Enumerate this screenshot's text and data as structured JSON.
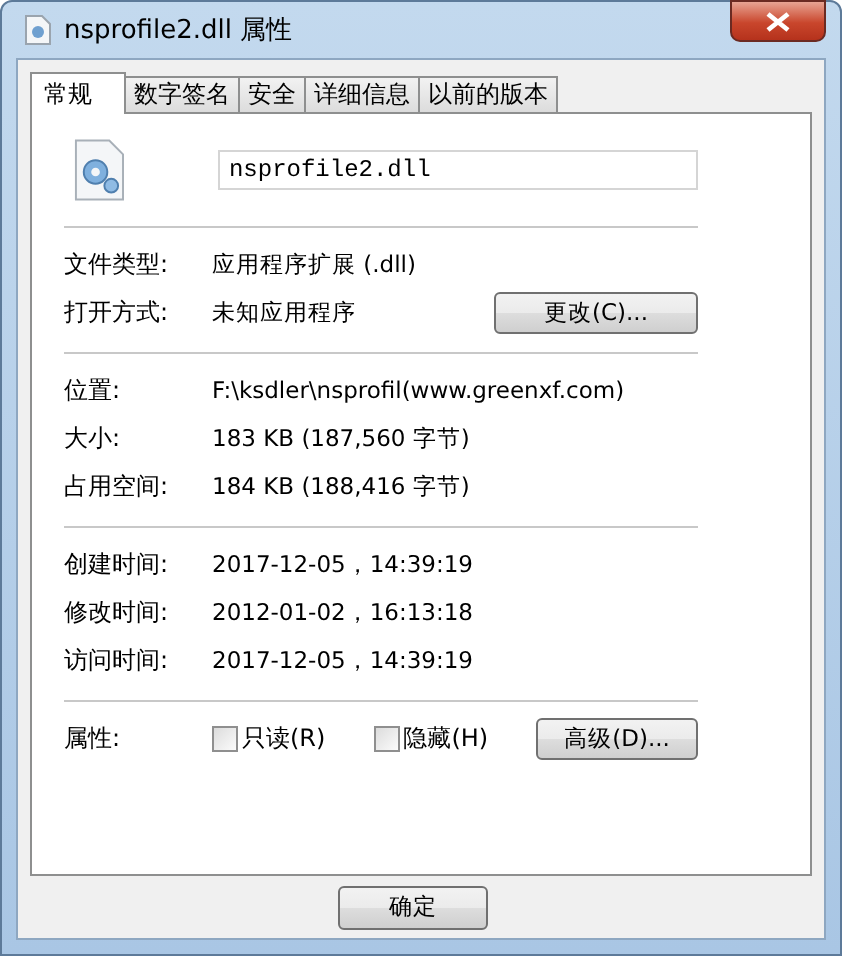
{
  "window": {
    "title": "nsprofile2.dll 属性"
  },
  "tabs": [
    {
      "label": "常规",
      "selected": true
    },
    {
      "label": "数字签名",
      "selected": false
    },
    {
      "label": "安全",
      "selected": false
    },
    {
      "label": "详细信息",
      "selected": false
    },
    {
      "label": "以前的版本",
      "selected": false
    }
  ],
  "file_name": {
    "value": "nsprofile2.dll"
  },
  "sections": [
    [
      {
        "label": "文件类型:",
        "value": "应用程序扩展 (.dll)"
      },
      {
        "label": "打开方式:",
        "value": "未知应用程序",
        "button": "更改(C)..."
      }
    ],
    [
      {
        "label": "位置:",
        "value": "F:\\ksdler\\nsprofil(www.greenxf.com)"
      },
      {
        "label": "大小:",
        "value": "183 KB (187,560 字节)"
      },
      {
        "label": "占用空间:",
        "value": "184 KB (188,416 字节)"
      }
    ],
    [
      {
        "label": "创建时间:",
        "value": "2017-12-05，14:39:19"
      },
      {
        "label": "修改时间:",
        "value": "2012-01-02，16:13:18"
      },
      {
        "label": "访问时间:",
        "value": "2017-12-05，14:39:19"
      }
    ]
  ],
  "attributes": {
    "label": "属性:",
    "checkboxes": [
      {
        "label": "只读(R)",
        "checked": false
      },
      {
        "label": "隐藏(H)",
        "checked": false
      }
    ],
    "button": "高级(D)..."
  },
  "buttons": [
    "确定"
  ]
}
